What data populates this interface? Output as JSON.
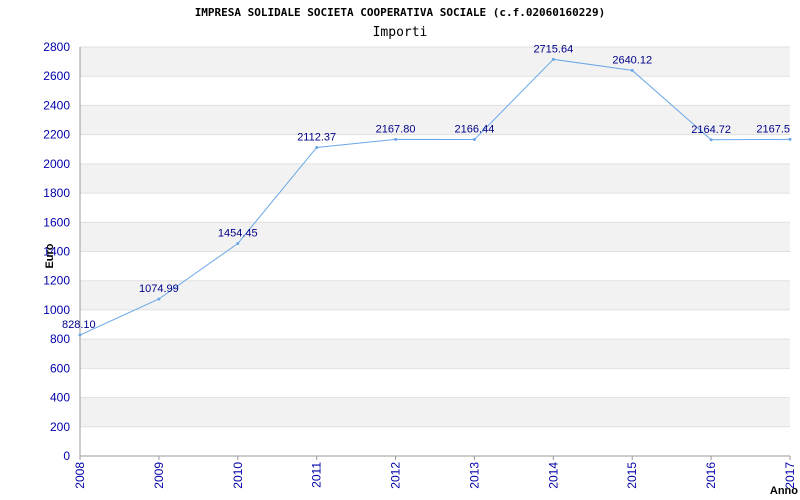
{
  "chart_data": {
    "type": "line",
    "title": "IMPRESA SOLIDALE SOCIETA COOPERATIVA SOCIALE (c.f.02060160229)",
    "subtitle": "Importi",
    "xlabel": "Anno",
    "ylabel": "Euro",
    "x": [
      "2008",
      "2009",
      "2010",
      "2011",
      "2012",
      "2013",
      "2014",
      "2015",
      "2016",
      "2017"
    ],
    "series": [
      {
        "values": [
          828.1,
          1074.99,
          1454.45,
          2112.37,
          2167.8,
          2166.44,
          2715.64,
          2640.12,
          2164.72,
          2167.5
        ],
        "labels": [
          "828.10",
          "1074.99",
          "1454.45",
          "2112.37",
          "2167.80",
          "2166.44",
          "2715.64",
          "2640.12",
          "2164.72",
          "2167.5"
        ],
        "color": "#6aa7e8"
      }
    ],
    "ylim": [
      0,
      2800
    ],
    "yticks": [
      0,
      200,
      400,
      600,
      800,
      1000,
      1200,
      1400,
      1600,
      1800,
      2000,
      2200,
      2400,
      2600,
      2800
    ],
    "grid": true,
    "band_colors": [
      "#ffffff",
      "#f2f2f2"
    ],
    "axis_color": "#999999"
  }
}
